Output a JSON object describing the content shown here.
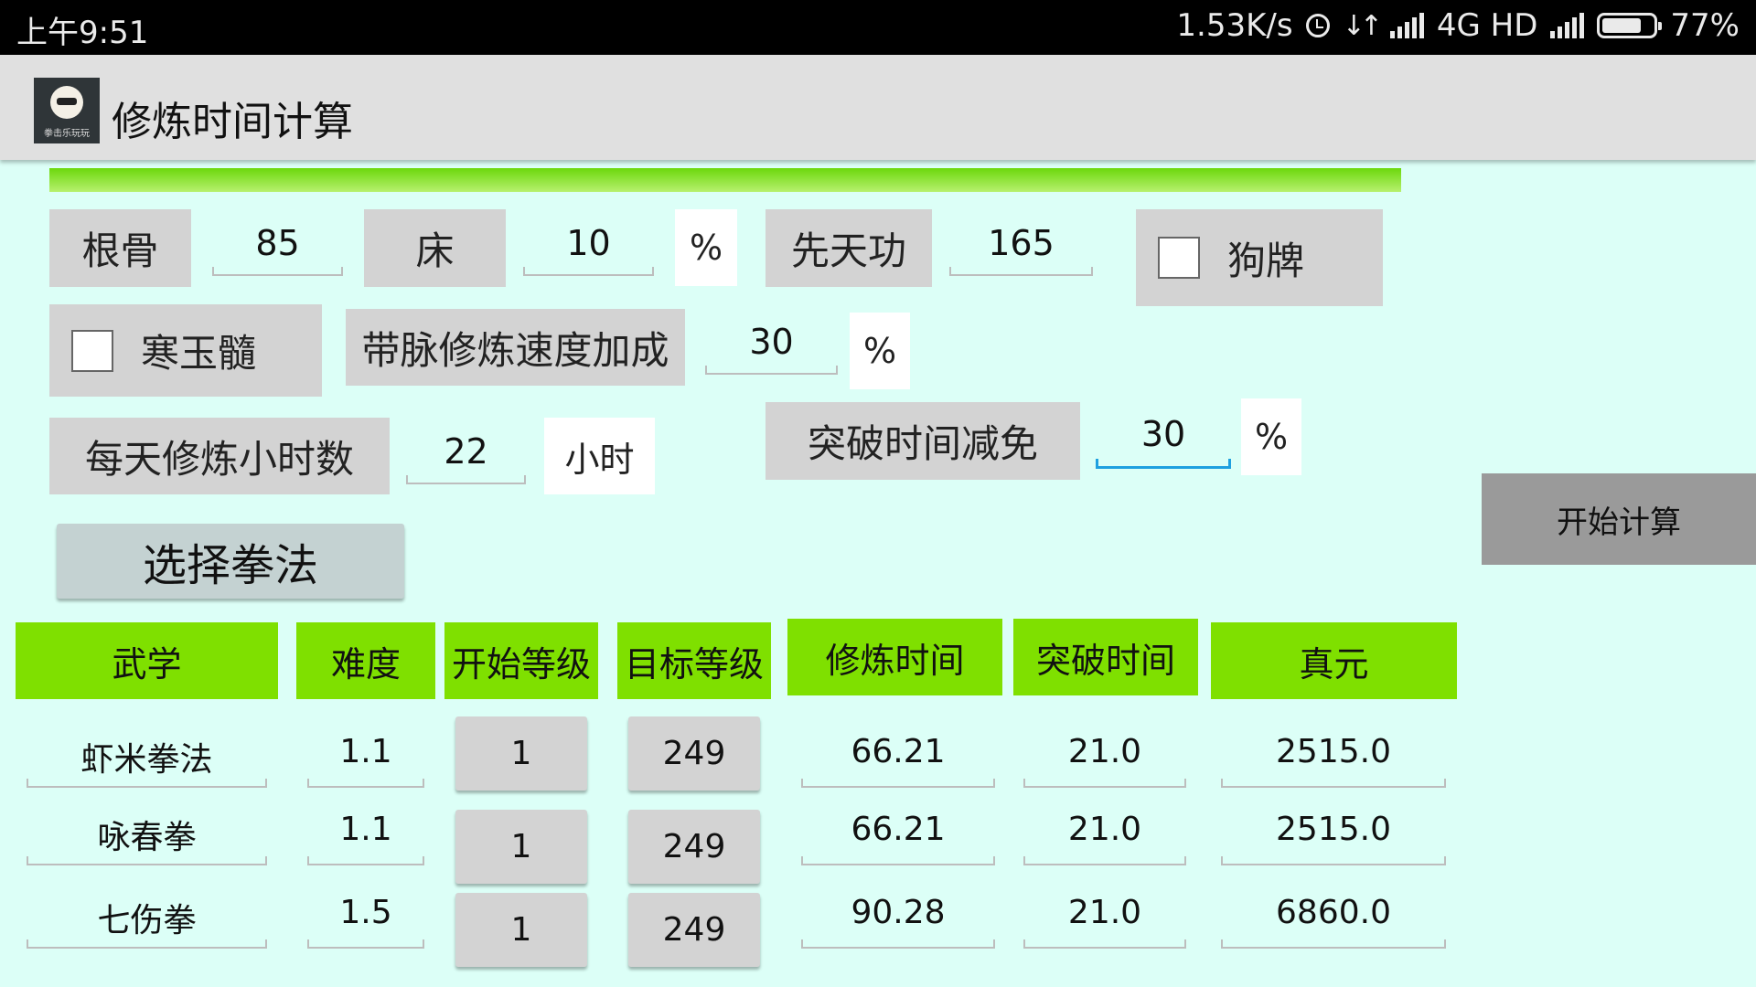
{
  "status_bar": {
    "time": "上午9:51",
    "network_speed": "1.53K/s",
    "network": "4G HD",
    "battery": "77%",
    "battery_level": 0.77,
    "icons": [
      "alarm-icon",
      "data-transfer-icon",
      "signal-icon",
      "signal-icon",
      "battery-icon"
    ]
  },
  "action_bar": {
    "title": "修炼时间计算",
    "icon_caption": "拳击乐玩玩"
  },
  "progress": {
    "fraction": 1.0,
    "color": "#7fe000"
  },
  "inputs": {
    "gengu": {
      "label": "根骨",
      "value": "85"
    },
    "bed": {
      "label": "床",
      "value": "10",
      "unit": "%"
    },
    "xiantiangong": {
      "label": "先天功",
      "value": "165"
    },
    "goupai": {
      "label": "狗牌",
      "checked": false
    },
    "hanyusui": {
      "label": "寒玉髓",
      "checked": false
    },
    "daimai": {
      "label": "带脉修炼速度加成",
      "value": "30",
      "unit": "%"
    },
    "hours": {
      "label": "每天修炼小时数",
      "value": "22",
      "unit": "小时"
    },
    "breakthrough": {
      "label": "突破时间减免",
      "value": "30",
      "unit": "%"
    }
  },
  "buttons": {
    "start": "开始计算",
    "select_style": "选择拳法"
  },
  "table": {
    "headers": [
      "武学",
      "难度",
      "开始等级",
      "目标等级",
      "修炼时间",
      "突破时间",
      "真元"
    ],
    "rows": [
      {
        "name": "虾米拳法",
        "difficulty": "1.1",
        "start_level": "1",
        "target_level": "249",
        "train_time": "66.21",
        "break_time": "21.0",
        "zhenyuan": "2515.0"
      },
      {
        "name": "咏春拳",
        "difficulty": "1.1",
        "start_level": "1",
        "target_level": "249",
        "train_time": "66.21",
        "break_time": "21.0",
        "zhenyuan": "2515.0"
      },
      {
        "name": "七伤拳",
        "difficulty": "1.5",
        "start_level": "1",
        "target_level": "249",
        "train_time": "90.28",
        "break_time": "21.0",
        "zhenyuan": "6860.0"
      }
    ]
  },
  "colors": {
    "background": "#dcfff7",
    "header_green": "#7fe000",
    "label_gray": "#d3d3d3",
    "focus_blue": "#1ea0e0"
  }
}
